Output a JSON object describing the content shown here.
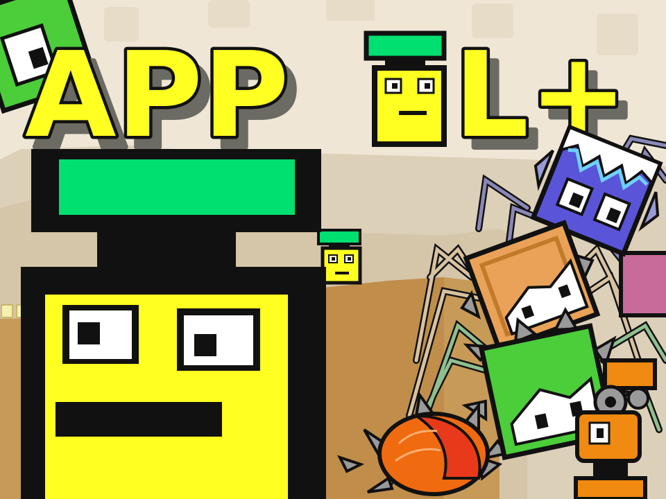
{
  "title": {
    "text_before": "APP",
    "text_after": "L+",
    "fill_color": "#ffff22",
    "outline_color": "#111111",
    "shadow_color": "#6b6b63"
  },
  "colors": {
    "background_sky": "#efe6d6",
    "background_hills": "#d9ccb5",
    "ground": "#c79a58",
    "player_body": "#ffff22",
    "player_hat": "#00e070",
    "outline": "#111111",
    "spider_blue": "#5a54d8",
    "spider_orange": "#e9a257",
    "spider_green": "#4ccd3a",
    "bug_red": "#e83a1a",
    "robot_orange": "#f08a10",
    "spike_gray": "#9a9a9a",
    "leg_purple": "#8a88b8",
    "leg_tan": "#d8c2a0",
    "leg_green": "#8fbf90"
  },
  "characters": [
    {
      "name": "appel-big",
      "kind": "player"
    },
    {
      "name": "appel-title-letter",
      "kind": "player"
    },
    {
      "name": "appel-small",
      "kind": "player"
    },
    {
      "name": "green-block-topleft",
      "kind": "enemy"
    },
    {
      "name": "blue-ice-spider",
      "kind": "enemy"
    },
    {
      "name": "orange-box-spider",
      "kind": "enemy"
    },
    {
      "name": "green-spiked-spider",
      "kind": "enemy"
    },
    {
      "name": "red-beetle",
      "kind": "enemy"
    },
    {
      "name": "orange-robot",
      "kind": "enemy"
    }
  ]
}
